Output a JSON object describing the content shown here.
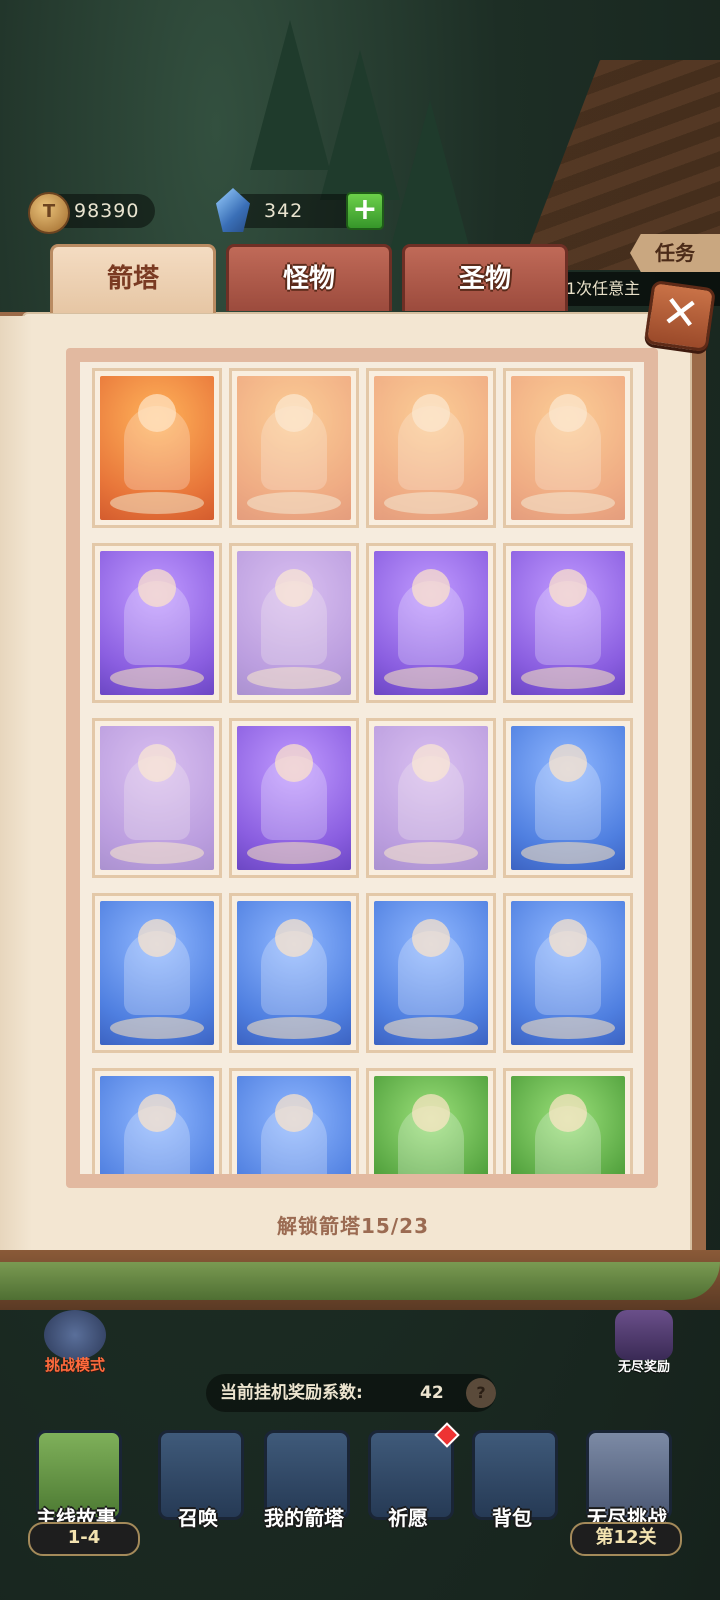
{
  "currency": {
    "coins": "98390",
    "gems": "342"
  },
  "icons": {
    "coin": "coin-icon",
    "gem": "gem-icon",
    "plus": "plus-icon",
    "close": "close-icon",
    "help": "question-icon"
  },
  "quest": {
    "tab_label": "任务",
    "text": "1次任意主"
  },
  "tabs": [
    {
      "label": "箭塔",
      "active": true
    },
    {
      "label": "怪物",
      "active": false
    },
    {
      "label": "圣物",
      "active": false
    }
  ],
  "towers": [
    {
      "rarity": "orange",
      "unlocked": true
    },
    {
      "rarity": "orange",
      "unlocked": false
    },
    {
      "rarity": "orange",
      "unlocked": false
    },
    {
      "rarity": "orange",
      "unlocked": false
    },
    {
      "rarity": "purple",
      "unlocked": true
    },
    {
      "rarity": "purple",
      "unlocked": false
    },
    {
      "rarity": "purple",
      "unlocked": true
    },
    {
      "rarity": "purple",
      "unlocked": true
    },
    {
      "rarity": "purple",
      "unlocked": false
    },
    {
      "rarity": "purple",
      "unlocked": true
    },
    {
      "rarity": "purple",
      "unlocked": false
    },
    {
      "rarity": "blue",
      "unlocked": true
    },
    {
      "rarity": "blue",
      "unlocked": true
    },
    {
      "rarity": "blue",
      "unlocked": true
    },
    {
      "rarity": "blue",
      "unlocked": true
    },
    {
      "rarity": "blue",
      "unlocked": true
    },
    {
      "rarity": "blue",
      "unlocked": true
    },
    {
      "rarity": "blue",
      "unlocked": true
    },
    {
      "rarity": "green",
      "unlocked": true
    },
    {
      "rarity": "green",
      "unlocked": true
    }
  ],
  "unlock_status": "解锁箭塔15/23",
  "hud": {
    "challenge_mode": "挑战模式",
    "endless_reward": "无尽奖励",
    "afk_rate_label": "当前挂机奖励系数:",
    "afk_rate_value": "42"
  },
  "nav": [
    {
      "label": "主线故事",
      "sub": "1-4"
    },
    {
      "label": "召唤"
    },
    {
      "label": "我的箭塔"
    },
    {
      "label": "祈愿"
    },
    {
      "label": "背包"
    },
    {
      "label": "无尽挑战",
      "sub": "第12关"
    }
  ],
  "colors": {
    "orange": "#e8763a",
    "purple": "#8a5ee0",
    "blue": "#4f7fe0",
    "green": "#4e9e3a"
  }
}
